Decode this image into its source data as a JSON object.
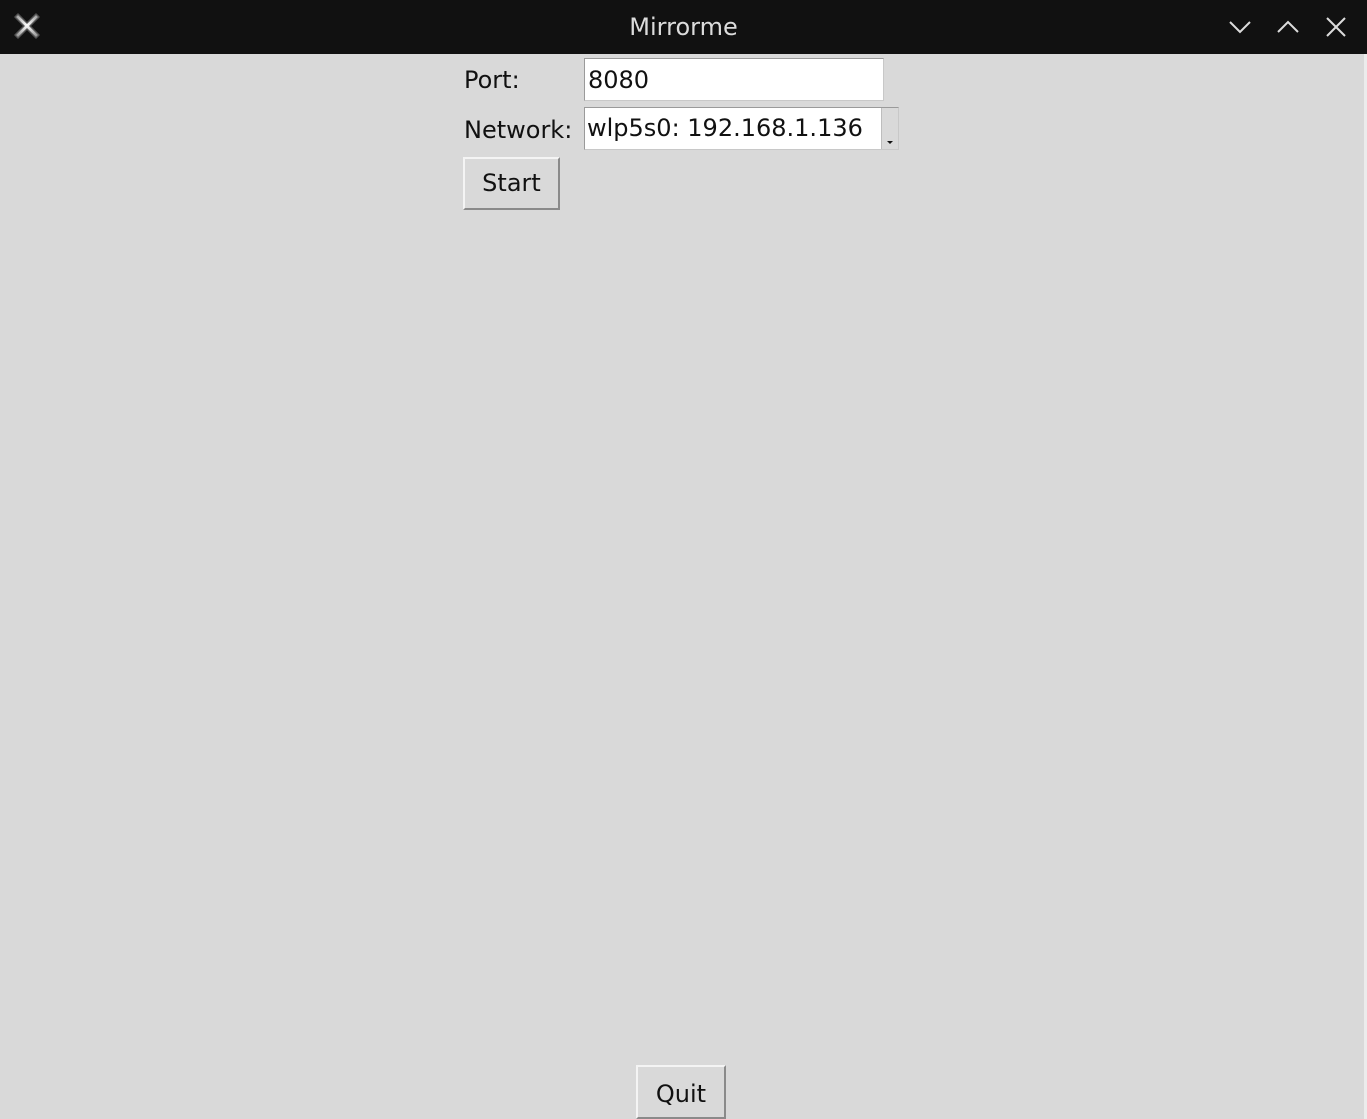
{
  "window": {
    "title": "Mirrorme",
    "icons": {
      "app": "x-logo-icon",
      "minimize": "chevron-down-icon",
      "maximize": "chevron-up-icon",
      "close": "close-icon"
    }
  },
  "form": {
    "port_label": "Port:",
    "port_value": "8080",
    "network_label": "Network:",
    "network_value": "wlp5s0: 192.168.1.136"
  },
  "buttons": {
    "start_label": "Start",
    "quit_label": "Quit"
  },
  "colors": {
    "background": "#d9d9d9",
    "titlebar": "#111111",
    "input_background": "#ffffff"
  }
}
